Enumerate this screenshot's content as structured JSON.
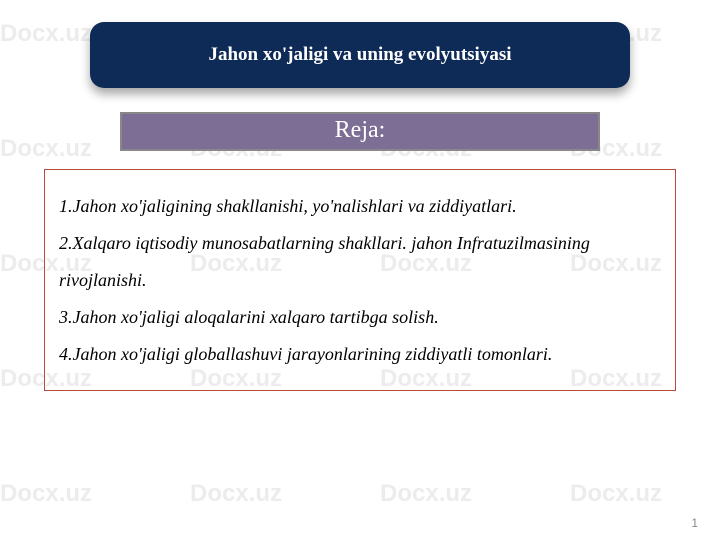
{
  "watermark_text": "Docx.uz",
  "title": "Jahon xo'jaligi va uning evolyutsiyasi",
  "reja_label": "Reja:",
  "items": [
    "1.Jahon xo'jaligining shakllanishi, yo'nalishlari va ziddiyatlari.",
    "2.Xalqaro iqtisodiy munosabatlarning shakllari. jahon Infratuzilmasining rivojlanishi.",
    "3.Jahon xo'jaligi aloqalarini xalqaro tartibga solish.",
    "4.Jahon xo'jaligi globallashuvi jarayonlarining ziddiyatli tomonlari."
  ],
  "page_number": "1"
}
